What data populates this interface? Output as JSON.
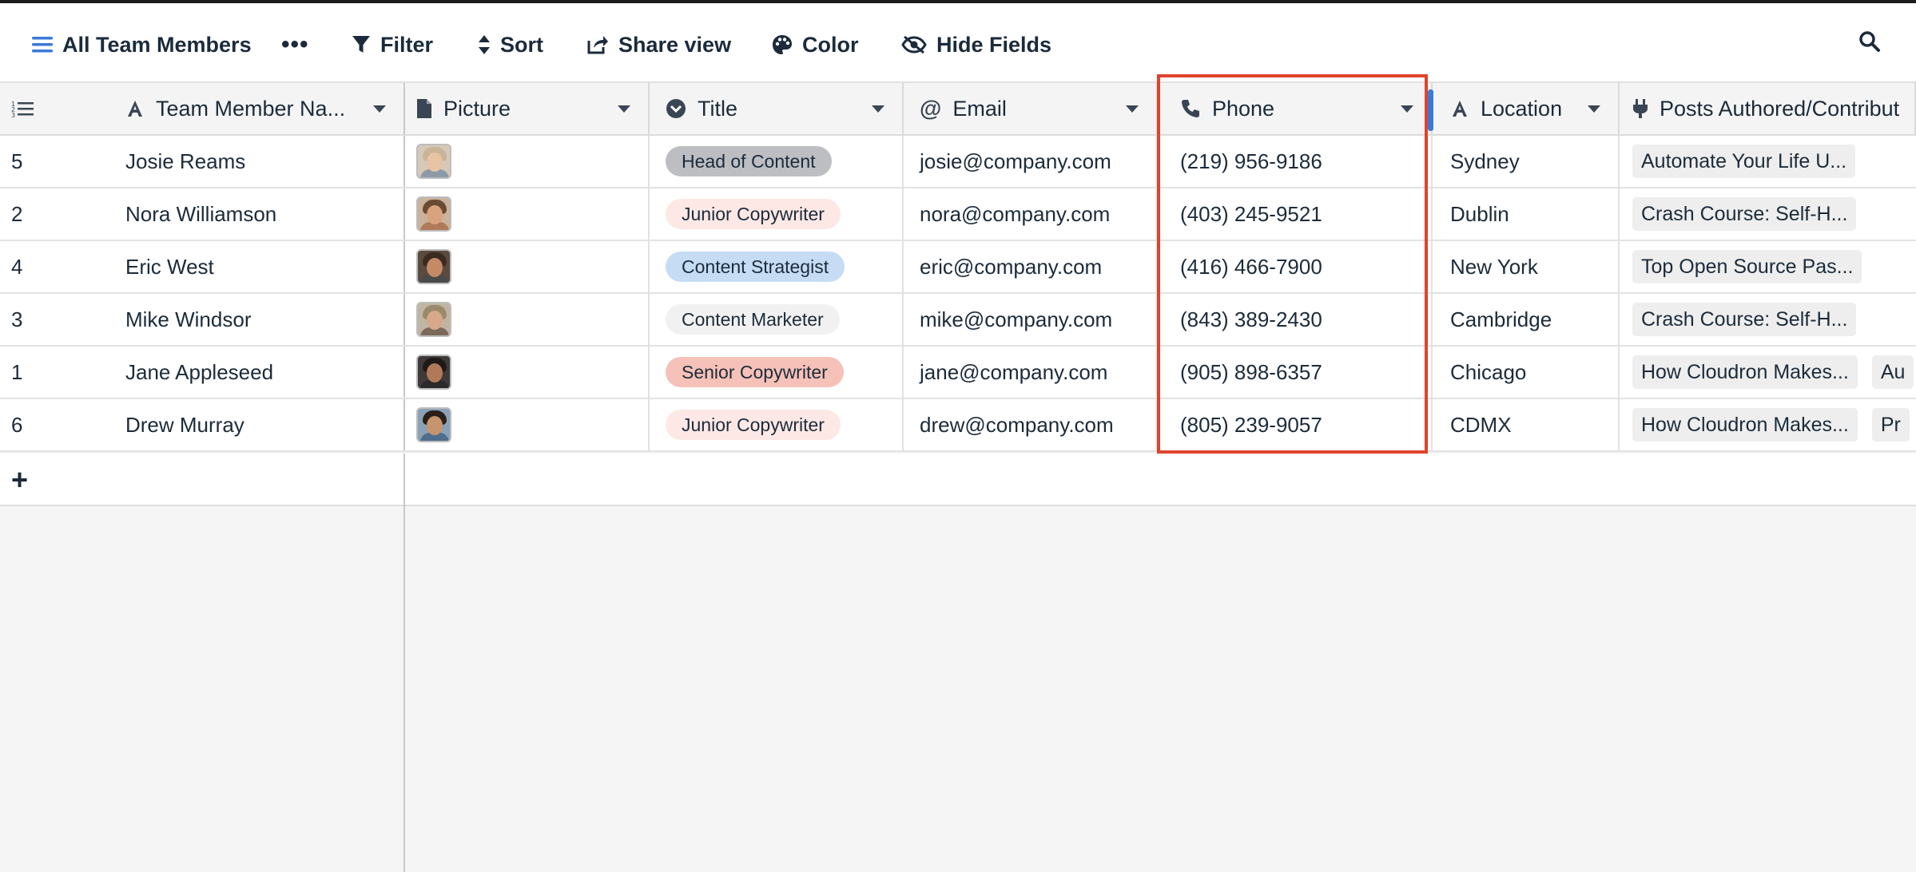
{
  "toolbar": {
    "view_name": "All Team Members",
    "more_label": "•••",
    "filter_label": "Filter",
    "sort_label": "Sort",
    "share_label": "Share view",
    "color_label": "Color",
    "hide_fields_label": "Hide Fields"
  },
  "columns": [
    {
      "label": "",
      "icon": "row-number-icon"
    },
    {
      "label": "Team Member Na...",
      "icon": "text-field-icon"
    },
    {
      "label": "Picture",
      "icon": "file-icon"
    },
    {
      "label": "Title",
      "icon": "single-select-icon"
    },
    {
      "label": "Email",
      "icon": "at-sign-icon"
    },
    {
      "label": "Phone",
      "icon": "phone-icon"
    },
    {
      "label": "Location",
      "icon": "text-field-icon"
    },
    {
      "label": "Posts Authored/Contribut",
      "icon": "plug-icon"
    }
  ],
  "rows": [
    {
      "id": "5",
      "name": "Josie Reams",
      "title": "Head of Content",
      "email": "josie@company.com",
      "phone": "(219) 956-9186",
      "location": "Sydney",
      "posts": [
        "Automate Your Life U..."
      ]
    },
    {
      "id": "2",
      "name": "Nora Williamson",
      "title": "Junior Copywriter",
      "email": "nora@company.com",
      "phone": "(403) 245-9521",
      "location": "Dublin",
      "posts": [
        "Crash Course: Self-H..."
      ]
    },
    {
      "id": "4",
      "name": "Eric West",
      "title": "Content Strategist",
      "email": "eric@company.com",
      "phone": "(416) 466-7900",
      "location": "New York",
      "posts": [
        "Top Open Source Pas..."
      ]
    },
    {
      "id": "3",
      "name": "Mike Windsor",
      "title": "Content Marketer",
      "email": "mike@company.com",
      "phone": "(843) 389-2430",
      "location": "Cambridge",
      "posts": [
        "Crash Course: Self-H..."
      ]
    },
    {
      "id": "1",
      "name": "Jane Appleseed",
      "title": "Senior Copywriter",
      "email": "jane@company.com",
      "phone": "(905) 898-6357",
      "location": "Chicago",
      "posts": [
        "How Cloudron Makes...",
        "Au"
      ]
    },
    {
      "id": "6",
      "name": "Drew Murray",
      "title": "Junior Copywriter",
      "email": "drew@company.com",
      "phone": "(805) 239-9057",
      "location": "CDMX",
      "posts": [
        "How Cloudron Makes...",
        "Pr"
      ]
    }
  ],
  "add_row_label": "+",
  "colors": {
    "accent": "#3b7ad9",
    "highlight_border": "#e0432c",
    "badge_head_of_content": "#bcbec2",
    "badge_junior_copywriter": "#fde8e6",
    "badge_content_strategist": "#c6dcf5",
    "badge_content_marketer": "#f1f1f1",
    "badge_senior_copywriter": "#f6c1b8"
  }
}
